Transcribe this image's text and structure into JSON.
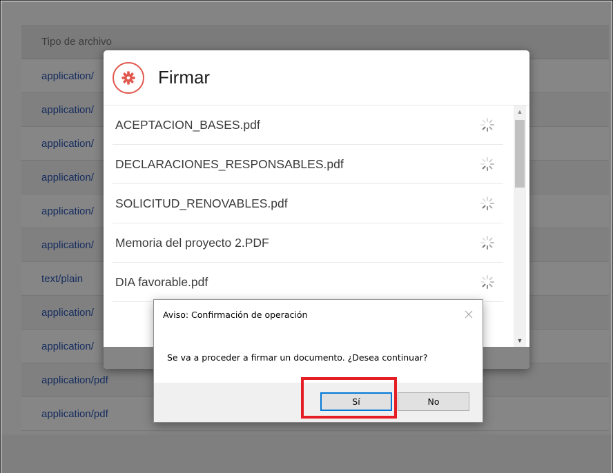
{
  "background_table": {
    "header": "Tipo de archivo",
    "rows": [
      "application/",
      "application/",
      "application/",
      "application/",
      "application/",
      "application/",
      "text/plain",
      "application/",
      "application/",
      "application/pdf",
      "application/pdf"
    ]
  },
  "modal": {
    "title": "Firmar",
    "icon": "gear-icon",
    "files": [
      {
        "name": "ACEPTACION_BASES.pdf",
        "status_icon": "spinner-icon"
      },
      {
        "name": "DECLARACIONES_RESPONSABLES.pdf",
        "status_icon": "spinner-icon"
      },
      {
        "name": "SOLICITUD_RENOVABLES.pdf",
        "status_icon": "spinner-icon"
      },
      {
        "name": "Memoria del proyecto 2.PDF",
        "status_icon": "spinner-icon"
      },
      {
        "name": "DIA favorable.pdf",
        "status_icon": "spinner-icon"
      }
    ],
    "accent_color": "#e0594f"
  },
  "dialog": {
    "title": "Aviso: Confirmación de operación",
    "message": "Se va a proceder a firmar un documento. ¿Desea continuar?",
    "yes_label": "Sí",
    "no_label": "No",
    "highlight_color": "#e51e25"
  }
}
